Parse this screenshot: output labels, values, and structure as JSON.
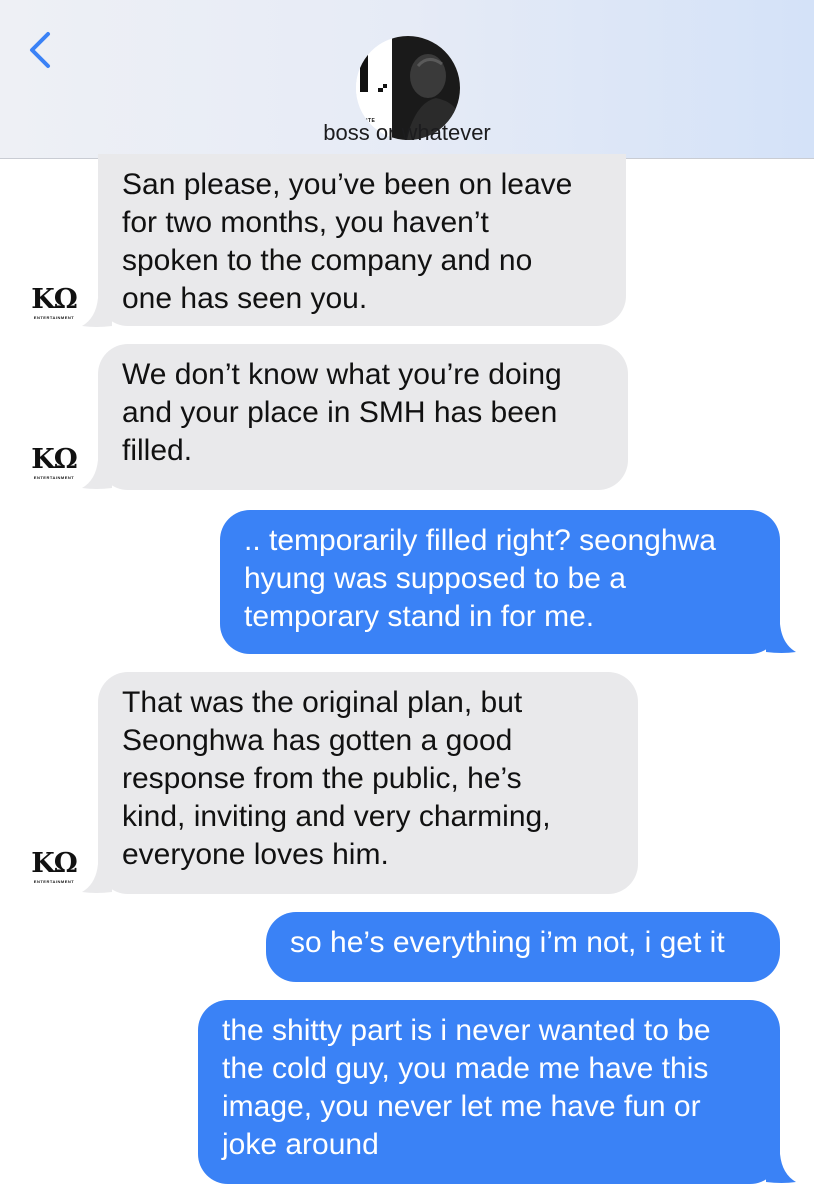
{
  "header": {
    "contact_name": "boss or whatever",
    "back_icon": "chevron-left-icon",
    "avatar_letter": "I",
    "avatar_label": "ENTE",
    "accent_color": "#3a82f6"
  },
  "logo": {
    "mark": "KΩ",
    "sub": "ENTERTAINMENT"
  },
  "messages": [
    {
      "direction": "received",
      "lines": [
        "San please, you’ve been on leave",
        "for two months, you haven’t",
        "spoken to the company and no",
        "one has seen you."
      ]
    },
    {
      "direction": "received",
      "lines": [
        "We don’t know what you’re doing",
        "and your place in SMH has been",
        "filled."
      ]
    },
    {
      "direction": "sent",
      "lines": [
        ".. temporarily filled right? seonghwa",
        "hyung was supposed to be a",
        "temporary stand in for me."
      ]
    },
    {
      "direction": "received",
      "lines": [
        "That was the original plan, but",
        "Seonghwa has gotten a good",
        "response from the public, he’s",
        "kind, inviting and very charming,",
        "everyone loves him."
      ]
    },
    {
      "direction": "sent",
      "lines": [
        "so he’s everything i’m not, i get it"
      ]
    },
    {
      "direction": "sent",
      "lines": [
        "the shitty part is i never wanted to be",
        "the cold guy, you made me have this",
        "image, you never let me have fun or",
        "joke around"
      ]
    }
  ],
  "colors": {
    "received_bubble": "#e9e9eb",
    "sent_bubble": "#3a82f6",
    "sent_text": "#ffffff"
  }
}
